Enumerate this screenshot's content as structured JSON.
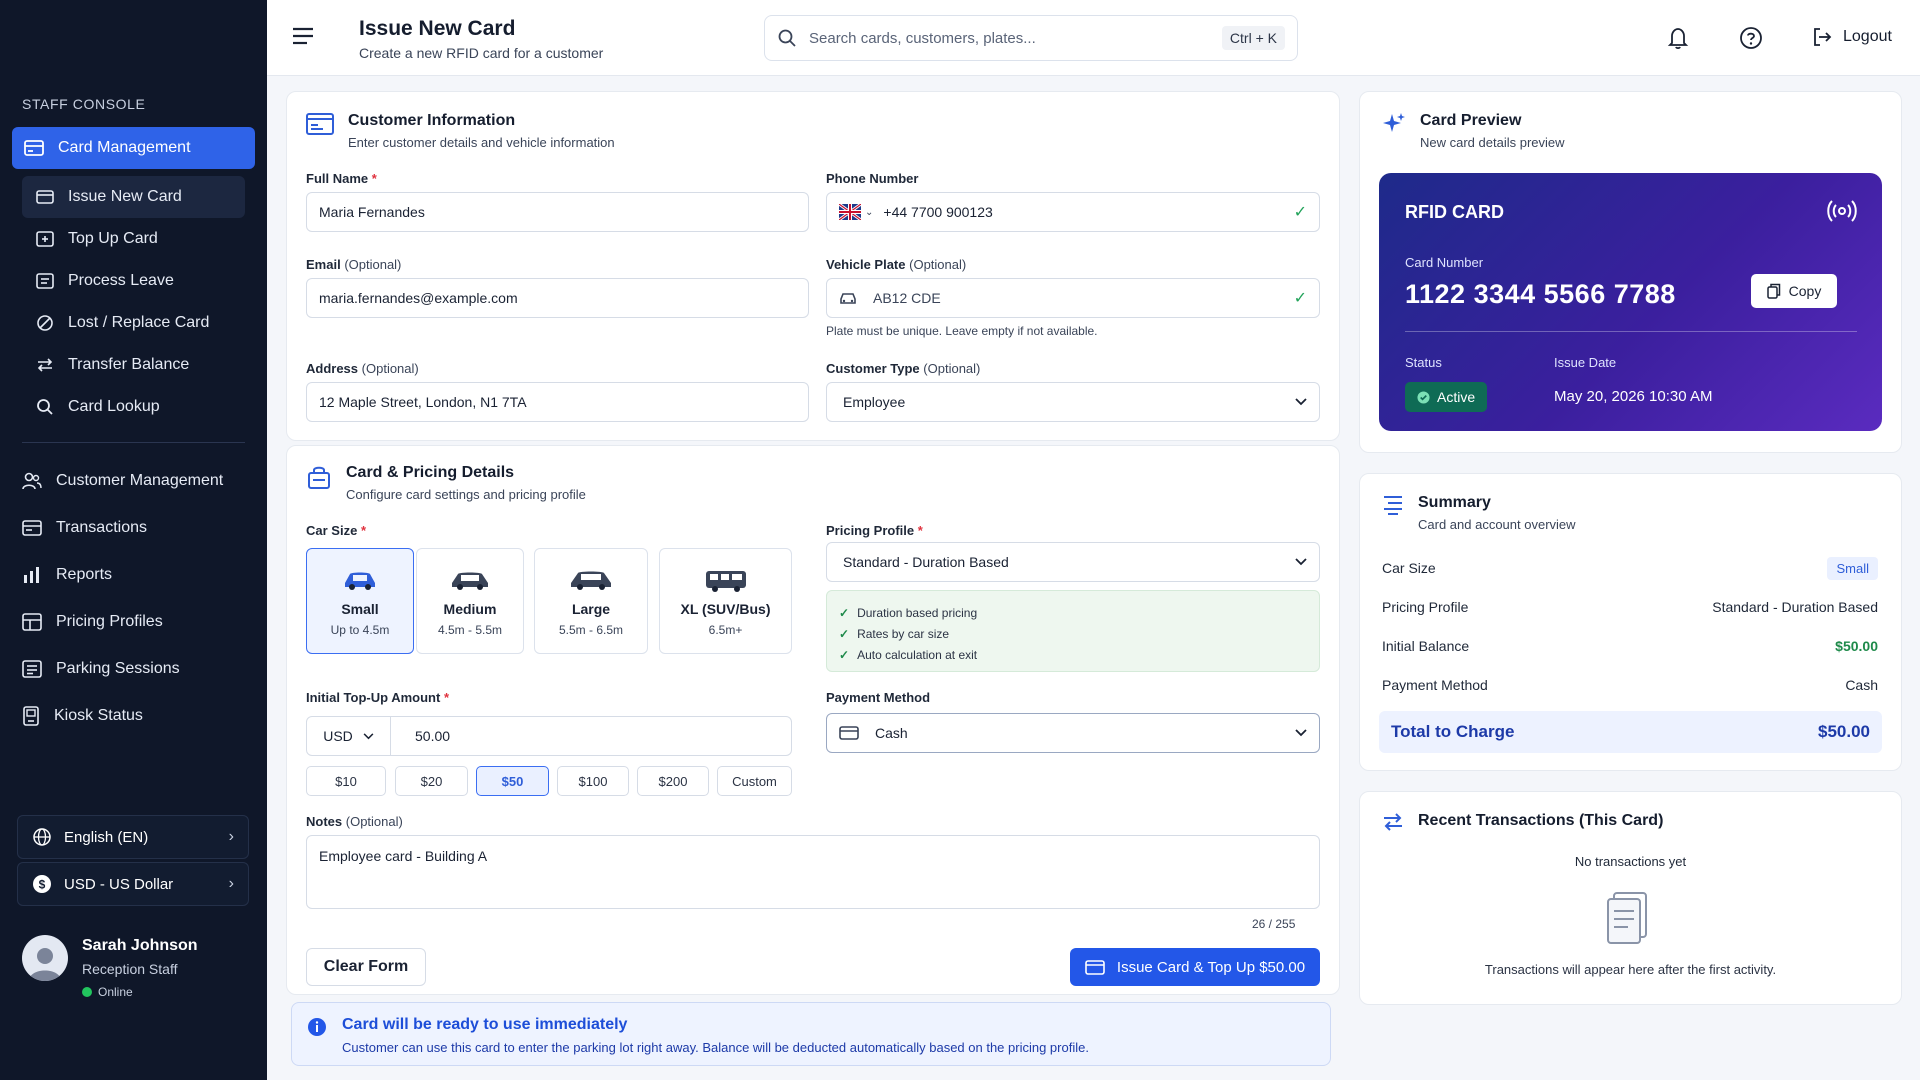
{
  "sidebar": {
    "console_label": "STAFF CONSOLE",
    "active_section": "Card Management",
    "sub_items": [
      {
        "label": "Issue New Card",
        "icon": "card-icon"
      },
      {
        "label": "Top Up Card",
        "icon": "topup-icon"
      },
      {
        "label": "Process Leave",
        "icon": "leave-icon"
      },
      {
        "label": "Lost / Replace Card",
        "icon": "replace-icon"
      },
      {
        "label": "Transfer Balance",
        "icon": "transfer-icon"
      },
      {
        "label": "Card Lookup",
        "icon": "search-icon"
      }
    ],
    "main_items": [
      {
        "label": "Customer Management",
        "icon": "users-icon"
      },
      {
        "label": "Transactions",
        "icon": "transactions-icon"
      },
      {
        "label": "Reports",
        "icon": "reports-icon"
      },
      {
        "label": "Pricing Profiles",
        "icon": "pricing-icon"
      },
      {
        "label": "Parking Sessions",
        "icon": "parking-icon"
      },
      {
        "label": "Kiosk Status",
        "icon": "kiosk-icon"
      }
    ],
    "language": "English (EN)",
    "currency": "USD - US Dollar",
    "user": {
      "name": "Sarah Johnson",
      "role": "Reception Staff",
      "status": "Online"
    }
  },
  "header": {
    "title": "Issue New Card",
    "subtitle": "Create a new RFID card for a customer",
    "search_placeholder": "Search cards, customers, plates...",
    "shortcut": "Ctrl + K",
    "logout": "Logout"
  },
  "customer": {
    "title": "Customer Information",
    "subtitle": "Enter customer details and vehicle information",
    "full_name_label": "Full Name",
    "full_name": "Maria Fernandes",
    "phone_label": "Phone Number",
    "phone": "+44 7700 900123",
    "email_label": "Email",
    "email": "maria.fernandes@example.com",
    "plate_label": "Vehicle Plate",
    "plate": "AB12 CDE",
    "plate_hint": "Plate must be unique. Leave empty if not available.",
    "address_label": "Address",
    "address": "12 Maple Street, London, N1 7TA",
    "type_label": "Customer Type",
    "type": "Employee",
    "optional": "(Optional)"
  },
  "pricing": {
    "title": "Card & Pricing Details",
    "subtitle": "Configure card settings and pricing profile",
    "car_size_label": "Car Size",
    "sizes": [
      {
        "name": "Small",
        "range": "Up to 4.5m"
      },
      {
        "name": "Medium",
        "range": "4.5m - 5.5m"
      },
      {
        "name": "Large",
        "range": "5.5m - 6.5m"
      },
      {
        "name": "XL (SUV/Bus)",
        "range": "6.5m+"
      }
    ],
    "profile_label": "Pricing Profile",
    "profile": "Standard - Duration Based",
    "features": [
      "Duration based pricing",
      "Rates by car size",
      "Auto calculation at exit"
    ],
    "topup_label": "Initial Top-Up Amount",
    "currency": "USD",
    "amount": "50.00",
    "quick_amounts": [
      "$10",
      "$20",
      "$50",
      "$100",
      "$200",
      "Custom"
    ],
    "payment_label": "Payment Method",
    "payment": "Cash",
    "notes_label": "Notes",
    "notes": "Employee card - Building A",
    "notes_count": "26 / 255",
    "clear_button": "Clear Form",
    "issue_button": "Issue Card & Top Up $50.00"
  },
  "banner": {
    "title": "Card will be ready to use immediately",
    "text": "Customer can use this card to enter the parking lot right away. Balance will be deducted automatically based on the pricing profile."
  },
  "preview": {
    "title": "Card Preview",
    "subtitle": "New card details preview",
    "card_title": "RFID CARD",
    "number_label": "Card Number",
    "number": "1122 3344 5566 7788",
    "copy": "Copy",
    "status_label": "Status",
    "status": "Active",
    "date_label": "Issue Date",
    "date": "May 20, 2026 10:30 AM"
  },
  "summary": {
    "title": "Summary",
    "subtitle": "Card and account overview",
    "rows": [
      {
        "label": "Car Size",
        "value": "Small"
      },
      {
        "label": "Pricing Profile",
        "value": "Standard - Duration Based"
      },
      {
        "label": "Initial Balance",
        "value": "$50.00"
      },
      {
        "label": "Payment Method",
        "value": "Cash"
      }
    ],
    "total_label": "Total to Charge",
    "total": "$50.00"
  },
  "recent": {
    "title": "Recent Transactions (This Card)",
    "empty_title": "No transactions yet",
    "empty_text": "Transactions will appear here after the first activity."
  },
  "colors": {
    "sidebar": "#0f1729",
    "accent": "#2f63e8",
    "success": "#22a35a"
  }
}
